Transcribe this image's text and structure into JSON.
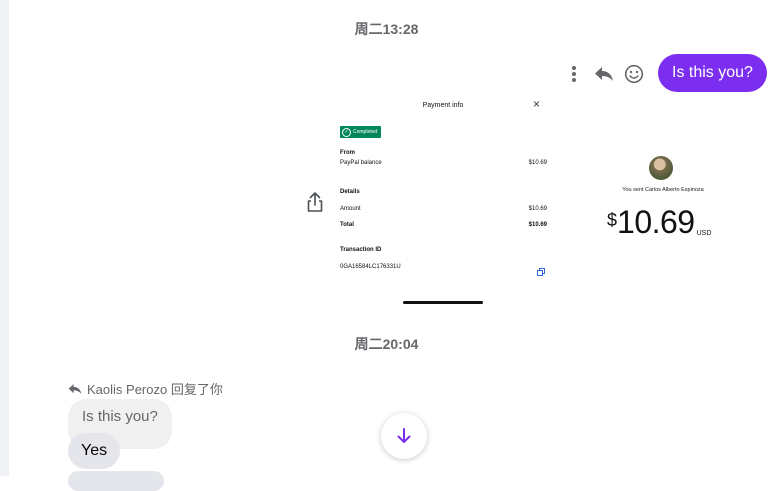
{
  "timestamps": {
    "first": "周二13:28",
    "second": "周二20:04"
  },
  "outgoing": {
    "text": "Is this you?"
  },
  "receipt": {
    "title": "Payment info",
    "close_glyph": "×",
    "status": "Completed",
    "from_label": "From",
    "from_source": "PayPal balance",
    "from_amount": "$10.69",
    "details_label": "Details",
    "amount_label": "Amount",
    "amount_value": "$10.69",
    "total_label": "Total",
    "total_value": "$10.69",
    "txn_label": "Transaction ID",
    "txn_id": "0GA16584LC176331U",
    "sent_to": "You sent Carlos Alberto Espinoza",
    "amount_sign": "$",
    "amount_big": "10.69",
    "currency": "USD"
  },
  "reply": {
    "context": "Kaolis Perozo 回复了你",
    "quoted": "Is this you?",
    "text": "Yes"
  },
  "icons": {
    "more": "more-vertical-icon",
    "reply": "reply-icon",
    "react": "emoji-icon",
    "share": "share-icon",
    "scroll": "arrow-down-icon"
  },
  "colors": {
    "accent": "#7c2ef0",
    "completed_badge": "#028858"
  }
}
